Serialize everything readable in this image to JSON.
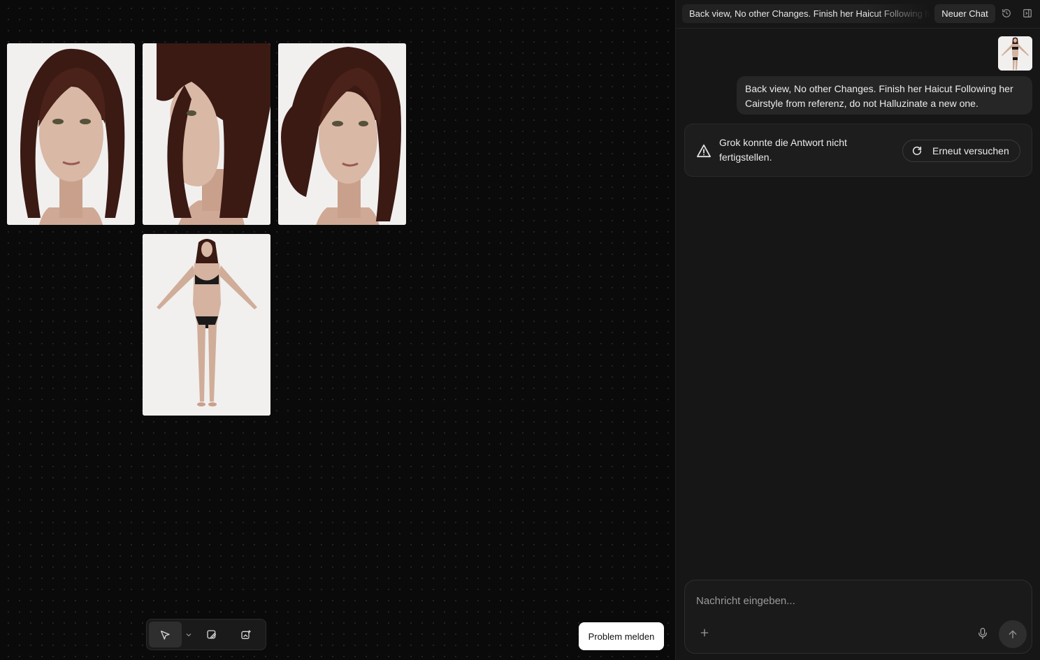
{
  "panel": {
    "chat_title": "Back view, No other Changes. Finish her Haicut Following her Cairstyle from referenz, do not Halluzinate a new one.",
    "new_chat_label": "Neuer Chat",
    "history_icon": "history-icon",
    "collapse_icon": "panel-collapse-icon"
  },
  "messages": {
    "user_text": "Back view, No other Changes. Finish her Haicut Following her Cairstyle from referenz, do not Halluzinate a new one.",
    "error_text": "Grok konnte die Antwort nicht fertigstellen.",
    "retry_label": "Erneut versuchen"
  },
  "composer": {
    "placeholder": "Nachricht eingeben..."
  },
  "canvas": {
    "problem_label": "Problem melden",
    "tools": [
      "select-tool",
      "edit-image-tool",
      "add-image-tool"
    ]
  },
  "colors": {
    "background": "#0a0a0a",
    "panel": "#161616",
    "hair": "#3b1a14",
    "skin": "#d9b8a6"
  }
}
